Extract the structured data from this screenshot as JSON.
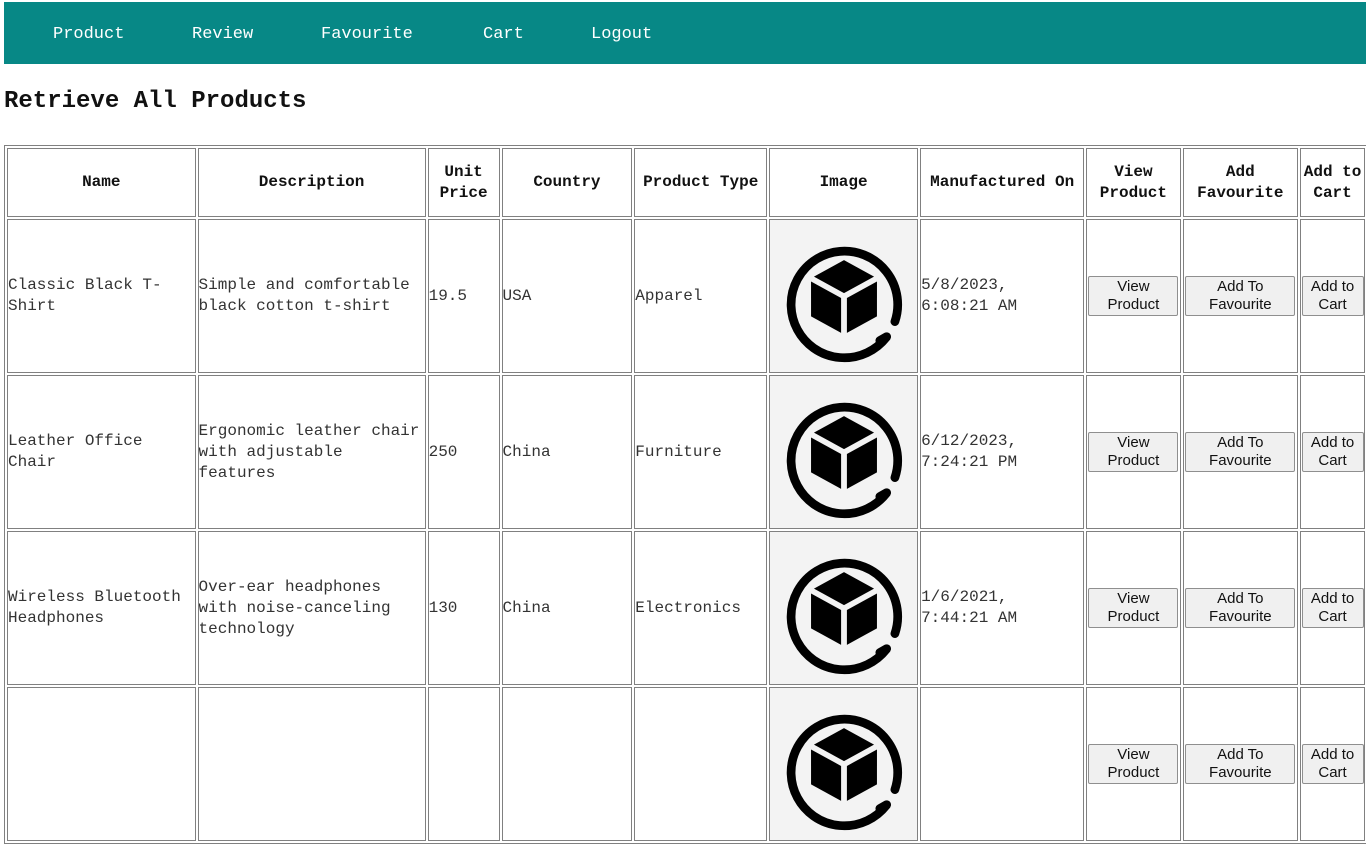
{
  "nav": {
    "items": [
      {
        "label": "Product"
      },
      {
        "label": "Review"
      },
      {
        "label": "Favourite"
      },
      {
        "label": "Cart"
      },
      {
        "label": "Logout"
      }
    ]
  },
  "page": {
    "title": "Retrieve All Products"
  },
  "table": {
    "headers": {
      "name": "Name",
      "description": "Description",
      "unit_price": "Unit Price",
      "country": "Country",
      "product_type": "Product Type",
      "image": "Image",
      "manufactured_on": "Manufactured On",
      "view_product": "View Product",
      "add_favourite": "Add Favourite",
      "add_to_cart": "Add to Cart"
    },
    "buttons": {
      "view": "View Product",
      "favourite": "Add To Favourite",
      "cart": "Add to Cart"
    },
    "rows": [
      {
        "name": "Classic Black T-Shirt",
        "description": "Simple and comfortable black cotton t-shirt",
        "unit_price": "19.5",
        "country": "USA",
        "product_type": "Apparel",
        "image_icon": "box-icon",
        "manufactured_on": "5/8/2023, 6:08:21 AM"
      },
      {
        "name": "Leather Office Chair",
        "description": "Ergonomic leather chair with adjustable features",
        "unit_price": "250",
        "country": "China",
        "product_type": "Furniture",
        "image_icon": "box-icon",
        "manufactured_on": "6/12/2023, 7:24:21 PM"
      },
      {
        "name": "Wireless Bluetooth Headphones",
        "description": "Over-ear headphones with noise-canceling technology",
        "unit_price": "130",
        "country": "China",
        "product_type": "Electronics",
        "image_icon": "box-icon",
        "manufactured_on": "1/6/2021, 7:44:21 AM"
      },
      {
        "name": "",
        "description": "",
        "unit_price": "",
        "country": "",
        "product_type": "",
        "image_icon": "box-icon",
        "manufactured_on": ""
      }
    ]
  },
  "colors": {
    "navbar_bg": "#078886",
    "nav_text": "#ffffff"
  }
}
